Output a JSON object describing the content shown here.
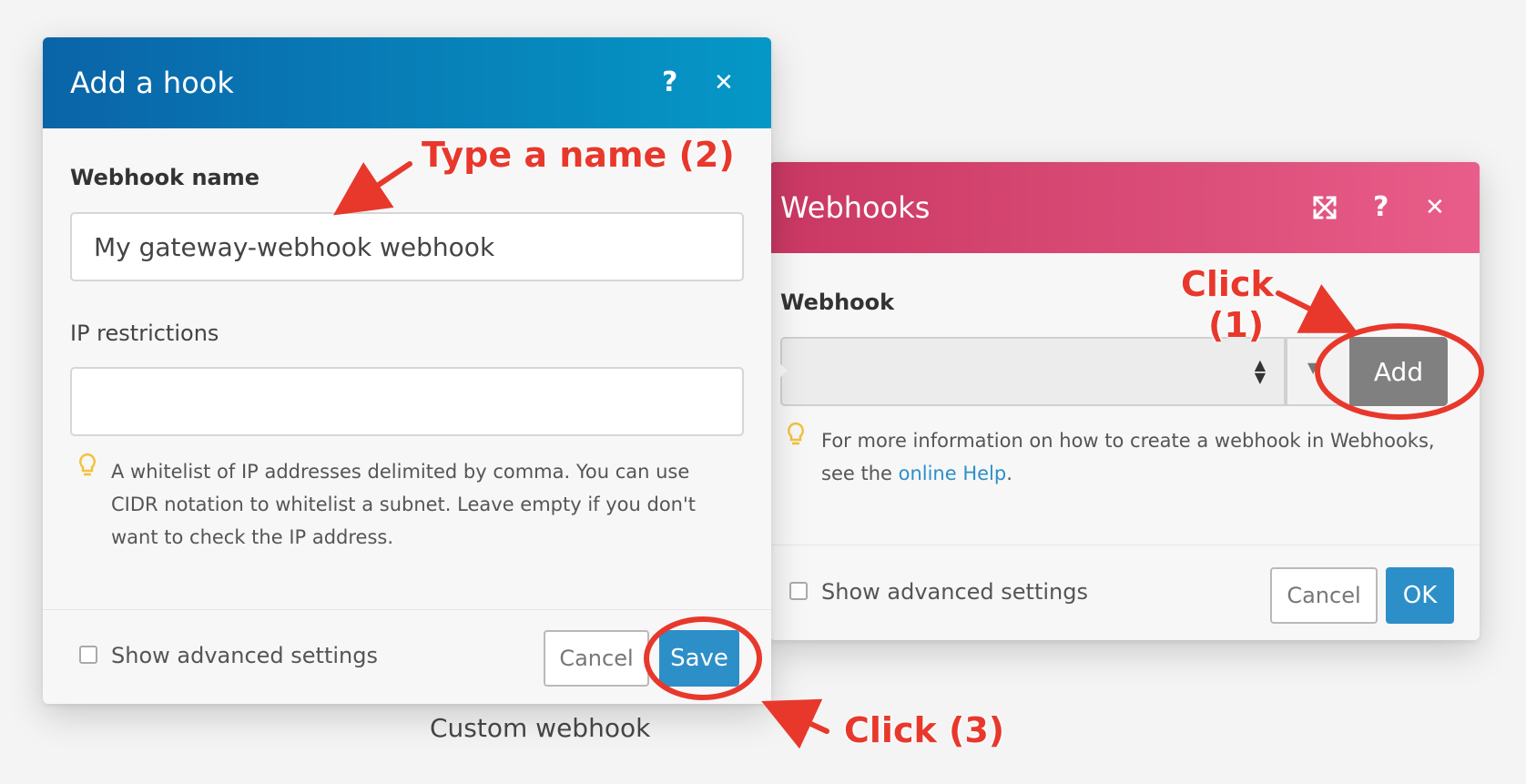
{
  "hook_dialog": {
    "title": "Add a hook",
    "webhook_name_label": "Webhook name",
    "webhook_name_value": "My gateway-webhook webhook",
    "ip_label": "IP restrictions",
    "ip_value": "",
    "help_line1": "A whitelist of IP addresses delimited by comma. You can use",
    "help_line2": "CIDR notation to whitelist a subnet. Leave empty if you don't",
    "help_line3": "want to check the IP address.",
    "advanced_label": "Show advanced settings",
    "cancel_label": "Cancel",
    "save_label": "Save",
    "header_color": "#0b6fae"
  },
  "webhooks_dialog": {
    "title": "Webhooks",
    "field_label": "Webhook",
    "select_value": "",
    "add_label": "Add",
    "help_line1": "For more information on how to create a webhook in Webhooks,",
    "help_prefix": "see the ",
    "help_link": "online Help",
    "help_suffix": ".",
    "advanced_label": "Show advanced settings",
    "cancel_label": "Cancel",
    "ok_label": "OK",
    "header_color": "#d63f6c"
  },
  "caption": "Custom webhook",
  "annotations": {
    "type_name": "Type a name (2)",
    "click1_a": "Click",
    "click1_b": "(1)",
    "click3": "Click (3)",
    "color": "#e8382c"
  },
  "icons": {
    "help": "?",
    "close": "✕",
    "expand": "expand-arrows-icon",
    "bulb": "lightbulb-icon"
  }
}
